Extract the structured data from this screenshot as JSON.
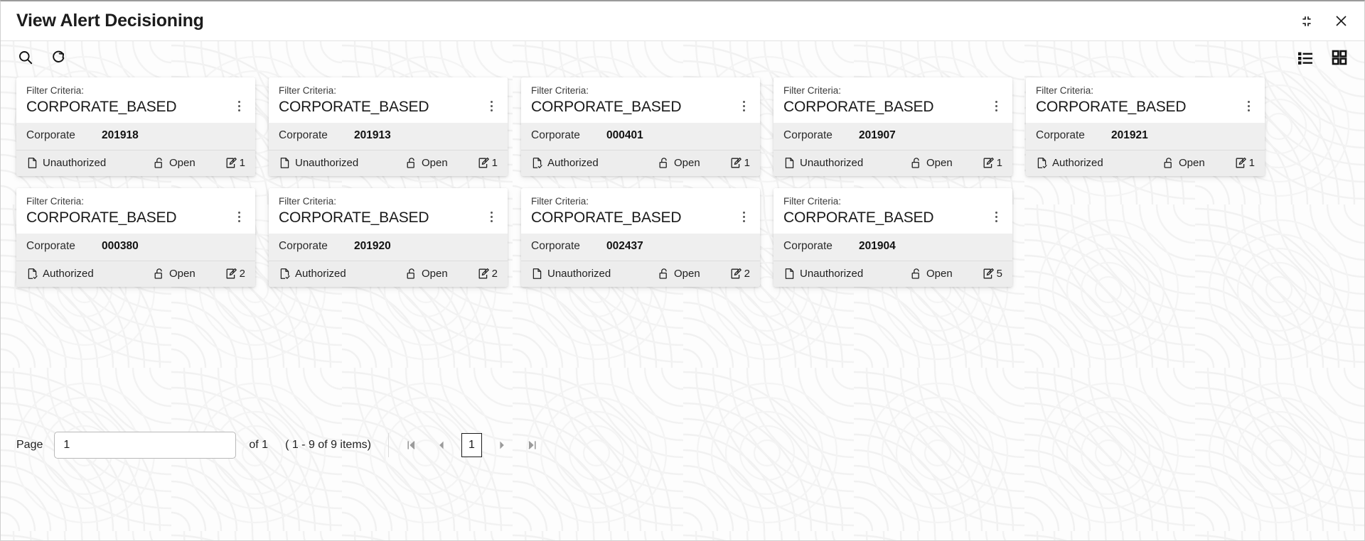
{
  "window": {
    "title": "View Alert Decisioning",
    "minimize_icon": "collapse-icon",
    "close_icon": "close-icon"
  },
  "toolbar": {
    "search_icon": "search-icon",
    "refresh_icon": "refresh-icon",
    "list_view_icon": "list-view-icon",
    "grid_view_icon": "grid-view-icon"
  },
  "card_common": {
    "filter_label": "Filter Criteria:",
    "corporate_key": "Corporate",
    "lock_status": "Open",
    "menu_icon": "kebab-menu-icon",
    "lock_icon": "unlock-icon",
    "edit_icon": "edit-square-icon",
    "authorized_icon": "document-check-icon",
    "unauthorized_icon": "document-icon"
  },
  "cards": [
    {
      "filter_value": "CORPORATE_BASED",
      "corporate_id": "201918",
      "auth_status": "Unauthorized",
      "authorized": false,
      "lock_status": "Open",
      "edit_count": "1"
    },
    {
      "filter_value": "CORPORATE_BASED",
      "corporate_id": "201913",
      "auth_status": "Unauthorized",
      "authorized": false,
      "lock_status": "Open",
      "edit_count": "1"
    },
    {
      "filter_value": "CORPORATE_BASED",
      "corporate_id": "000401",
      "auth_status": "Authorized",
      "authorized": true,
      "lock_status": "Open",
      "edit_count": "1"
    },
    {
      "filter_value": "CORPORATE_BASED",
      "corporate_id": "201907",
      "auth_status": "Unauthorized",
      "authorized": false,
      "lock_status": "Open",
      "edit_count": "1"
    },
    {
      "filter_value": "CORPORATE_BASED",
      "corporate_id": "201921",
      "auth_status": "Authorized",
      "authorized": true,
      "lock_status": "Open",
      "edit_count": "1"
    },
    {
      "filter_value": "CORPORATE_BASED",
      "corporate_id": "000380",
      "auth_status": "Authorized",
      "authorized": true,
      "lock_status": "Open",
      "edit_count": "2"
    },
    {
      "filter_value": "CORPORATE_BASED",
      "corporate_id": "201920",
      "auth_status": "Authorized",
      "authorized": true,
      "lock_status": "Open",
      "edit_count": "2"
    },
    {
      "filter_value": "CORPORATE_BASED",
      "corporate_id": "002437",
      "auth_status": "Unauthorized",
      "authorized": false,
      "lock_status": "Open",
      "edit_count": "2"
    },
    {
      "filter_value": "CORPORATE_BASED",
      "corporate_id": "201904",
      "auth_status": "Unauthorized",
      "authorized": false,
      "lock_status": "Open",
      "edit_count": "5"
    }
  ],
  "pagination": {
    "page_label": "Page",
    "page_value": "1",
    "of_text": "of 1",
    "range_text": "( 1 - 9 of 9 items)",
    "current_page": "1",
    "first_icon": "first-page-icon",
    "prev_icon": "prev-page-icon",
    "next_icon": "next-page-icon",
    "last_icon": "last-page-icon"
  },
  "colors": {
    "card_header_bg": "#ffffff",
    "card_body_bg": "#efefef",
    "card_footer_bg": "#ededed",
    "text_primary": "#1a1a1a",
    "disabled_arrow": "#9b9b9b"
  }
}
